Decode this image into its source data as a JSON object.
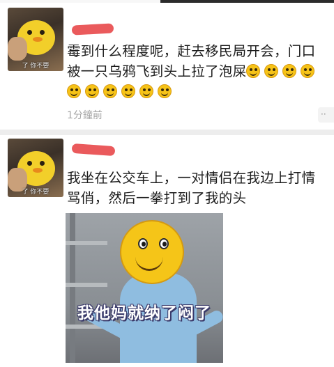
{
  "colors": {
    "background": "#ededed",
    "card": "#ffffff",
    "text": "#1c1c1c",
    "timestamp": "#a6a6a6",
    "redaction": "#e8484a",
    "emoji": "#f6c318"
  },
  "posts": [
    {
      "avatar_caption": "了 你不要",
      "lines": [
        "霉到什么程度呢，赶去移民局开会，门口",
        "被一只乌鸦飞到头上拉了泡屎"
      ],
      "inline_emoji_count": 4,
      "emoji_row_count": 6,
      "emoji_icon": "smile-emoji-icon",
      "time": "1分鐘前",
      "more_label": "··"
    },
    {
      "avatar_caption": "了 你不要",
      "lines": [
        "我坐在公交车上，一对情侣在我边上打情",
        "骂俏，然后一拳打到了我的头"
      ],
      "meme_caption": "我他妈就纳了闷了"
    }
  ]
}
